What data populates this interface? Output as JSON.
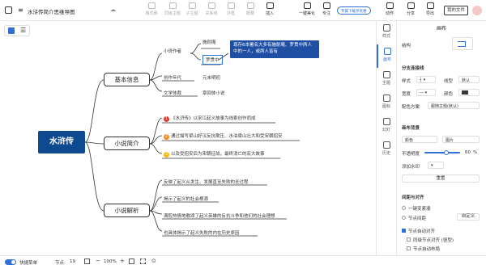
{
  "app": {
    "title": "水浒传简介思维导图"
  },
  "toolbar": {
    "items": [
      {
        "label": "格式刷"
      },
      {
        "label": "同级主题"
      },
      {
        "label": "子主题"
      },
      {
        "label": "关系线"
      },
      {
        "label": "外框"
      },
      {
        "label": "概要"
      },
      {
        "label": "插入"
      },
      {
        "label": "一键美化"
      },
      {
        "label": "专注"
      },
      {
        "label": "动作"
      },
      {
        "label": "分享"
      },
      {
        "label": "导出"
      }
    ],
    "pro_badge": "专属下载享优惠",
    "my_file": "我的文件"
  },
  "mind": {
    "root": "水浒传",
    "branches": [
      {
        "label": "基本信息"
      },
      {
        "label": "小说简介"
      },
      {
        "label": "小说解析"
      }
    ],
    "info": {
      "author": "小说作者",
      "authors": [
        "施耐庵",
        "罗贯中"
      ],
      "callout": "现存6本署名大多有施耐庵、罗贯中两人中的一人，或两人皆有",
      "era_label": "创作年代",
      "era": "元末明初",
      "genre_label": "文学体裁",
      "genre": "章回体小说"
    },
    "intro": [
      {
        "num": "1",
        "color": "#e03c31",
        "text": "《水浒传》以宋江起义故事为线索创作而成"
      },
      {
        "num": "2",
        "color": "#f08a24",
        "text": "通过描写梁山好汉反抗欺压、水泊梁山壮大和受宋朝招安"
      },
      {
        "num": "3",
        "color": "#f5b800",
        "text": "以及受招安后为宋朝征战，最终消亡的宏大故事"
      }
    ],
    "analysis": [
      "反映了起义从发生、发展直至失败的全过程",
      "揭示了起义的社会根源",
      "满腔热情地歌颂了起义英雄的反抗斗争和他们的社会理想",
      "也具体揭示了起义失败的内在历史原因"
    ]
  },
  "sidetabs": [
    {
      "label": "样式"
    },
    {
      "label": "画布"
    },
    {
      "label": "主题"
    },
    {
      "label": "图标"
    },
    {
      "label": "幻灯"
    },
    {
      "label": "历史"
    }
  ],
  "panel": {
    "title": "画布",
    "structure": "结构",
    "branch_section": "分支连接线",
    "style": "样式",
    "line_type": "线型",
    "line_type_val": "默认",
    "width": "宽度",
    "color": "颜色",
    "color_scheme": "配色方案",
    "color_scheme_val": "跟随主题(默认)",
    "bg_section": "画布背景",
    "bg": "颜色",
    "image": "图片",
    "opacity": "不透明度",
    "opacity_val": "60",
    "watermark": "添加水印",
    "reset": "重置",
    "spacing_section": "间距与对齐",
    "one_key": "一键变紧凑",
    "node_spacing": "节点间距",
    "custom": "自定义",
    "align": "节点自动对齐",
    "same_level": "同级节点对齐 (竖型)",
    "auto_layout": "节点自动布局"
  },
  "bottom": {
    "quick": "快捷菜单",
    "count_label": "节点:",
    "count": "19",
    "zoom": "100%"
  },
  "colors": {
    "accent": "#2f6fd6",
    "root": "#0d4a8f",
    "callout": "#1f4fa3"
  }
}
